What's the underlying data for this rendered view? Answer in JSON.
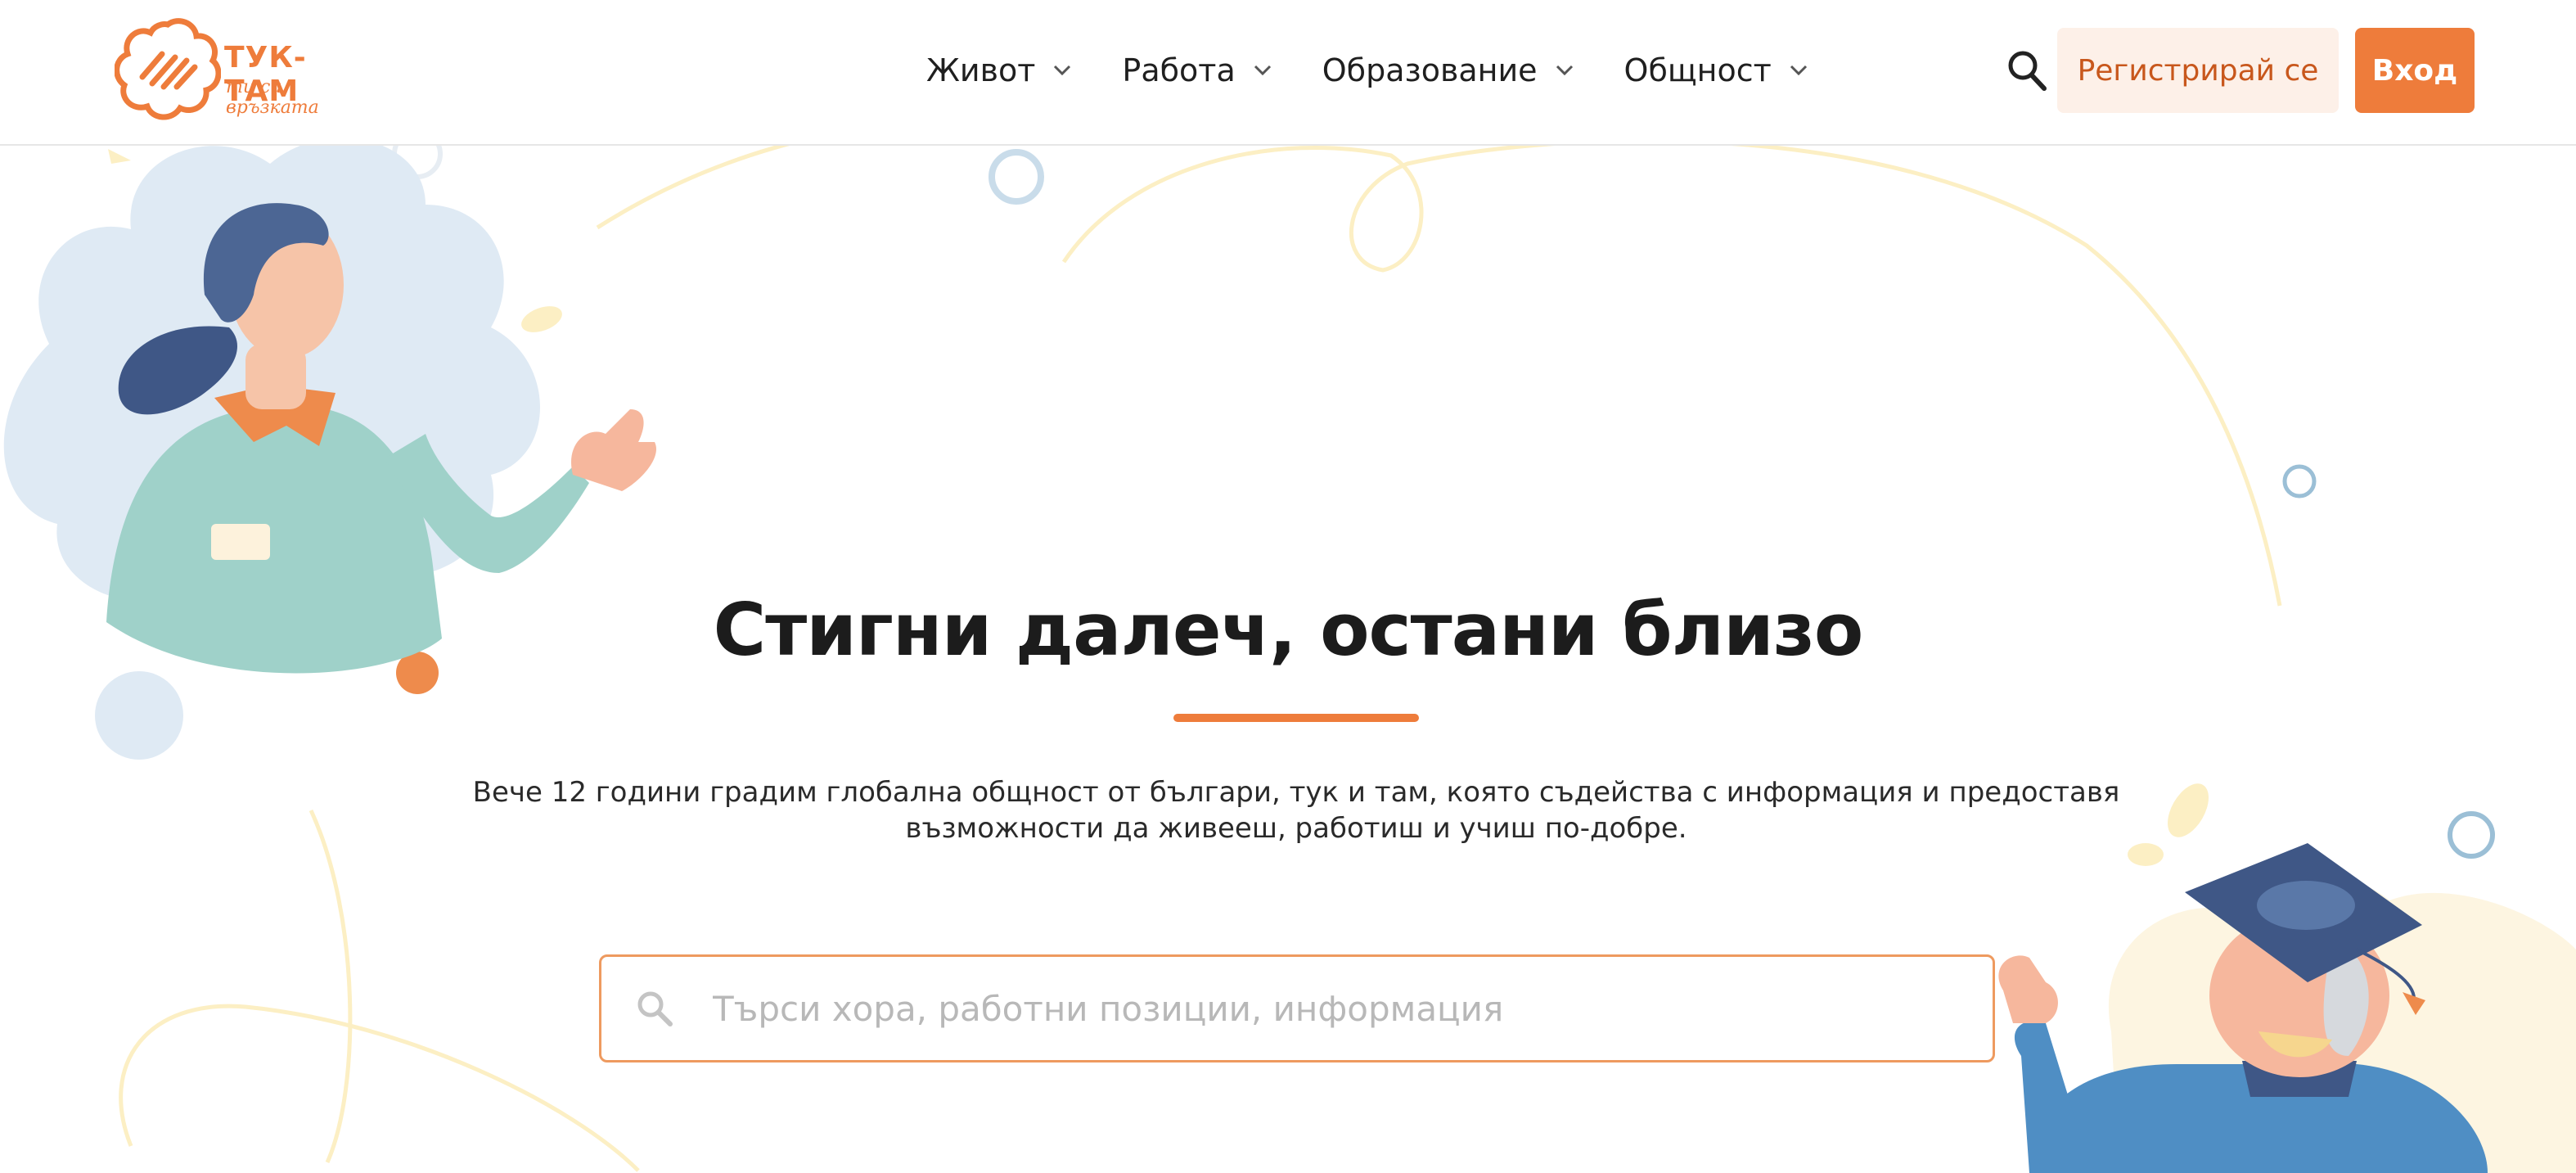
{
  "brand": {
    "name": "ТУК-ТАМ",
    "tagline": "ти си връзката",
    "color": "#ee7c3b"
  },
  "nav": {
    "items": [
      {
        "label": "Живот",
        "icon": "chevron-down-icon"
      },
      {
        "label": "Работа",
        "icon": "chevron-down-icon"
      },
      {
        "label": "Образование",
        "icon": "chevron-down-icon"
      },
      {
        "label": "Общност",
        "icon": "chevron-down-icon"
      }
    ],
    "search_icon": "search-icon",
    "register_label": "Регистрирай се",
    "login_label": "Вход"
  },
  "hero": {
    "title": "Стигни далеч, остани близо",
    "description": "Вече 12 години градим глобална общност от българи, тук и там, която съдейства с информация и предоставя възможности да живееш, работиш и учиш по-добре.",
    "search_placeholder": "Търси хора, работни позиции, информация"
  },
  "colors": {
    "accent": "#ee7c3b",
    "register_bg": "#fdf0e8",
    "register_text": "#c8571c"
  }
}
